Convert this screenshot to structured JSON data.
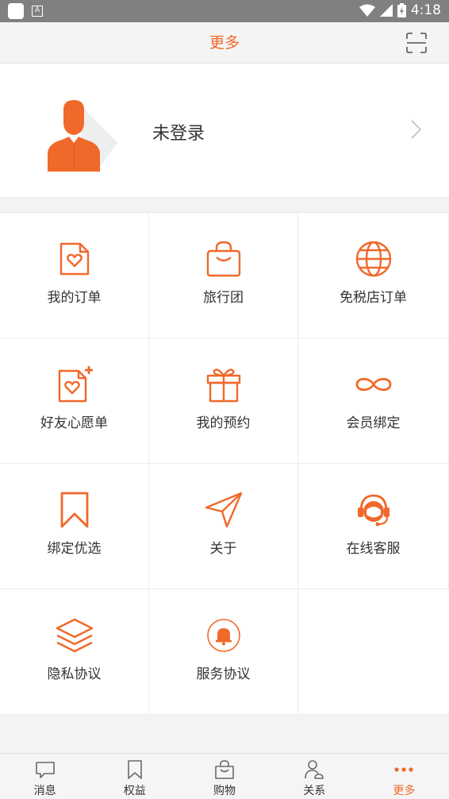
{
  "status_bar": {
    "time": "4:18"
  },
  "header": {
    "title": "更多"
  },
  "profile": {
    "login_label": "未登录"
  },
  "menu": {
    "items": [
      {
        "label": "我的订单",
        "icon": "heart-document-icon"
      },
      {
        "label": "旅行团",
        "icon": "shopping-bag-icon"
      },
      {
        "label": "免税店订单",
        "icon": "globe-icon"
      },
      {
        "label": "好友心愿单",
        "icon": "heart-document-plus-icon"
      },
      {
        "label": "我的预约",
        "icon": "gift-box-icon"
      },
      {
        "label": "会员绑定",
        "icon": "infinity-link-icon"
      },
      {
        "label": "绑定优选",
        "icon": "bookmark-icon"
      },
      {
        "label": "关于",
        "icon": "paper-plane-icon"
      },
      {
        "label": "在线客服",
        "icon": "headset-agent-icon"
      },
      {
        "label": "隐私协议",
        "icon": "layers-icon"
      },
      {
        "label": "服务协议",
        "icon": "bell-icon"
      }
    ]
  },
  "tab_bar": {
    "tabs": [
      {
        "label": "消息",
        "icon": "message-icon"
      },
      {
        "label": "权益",
        "icon": "bookmark-icon"
      },
      {
        "label": "购物",
        "icon": "shopping-bag-icon"
      },
      {
        "label": "关系",
        "icon": "contacts-icon"
      },
      {
        "label": "更多",
        "icon": "more-dots-icon"
      }
    ],
    "active_index": 4
  },
  "colors": {
    "accent": "#f0692a",
    "text": "#333333",
    "status_bar": "#808080"
  }
}
